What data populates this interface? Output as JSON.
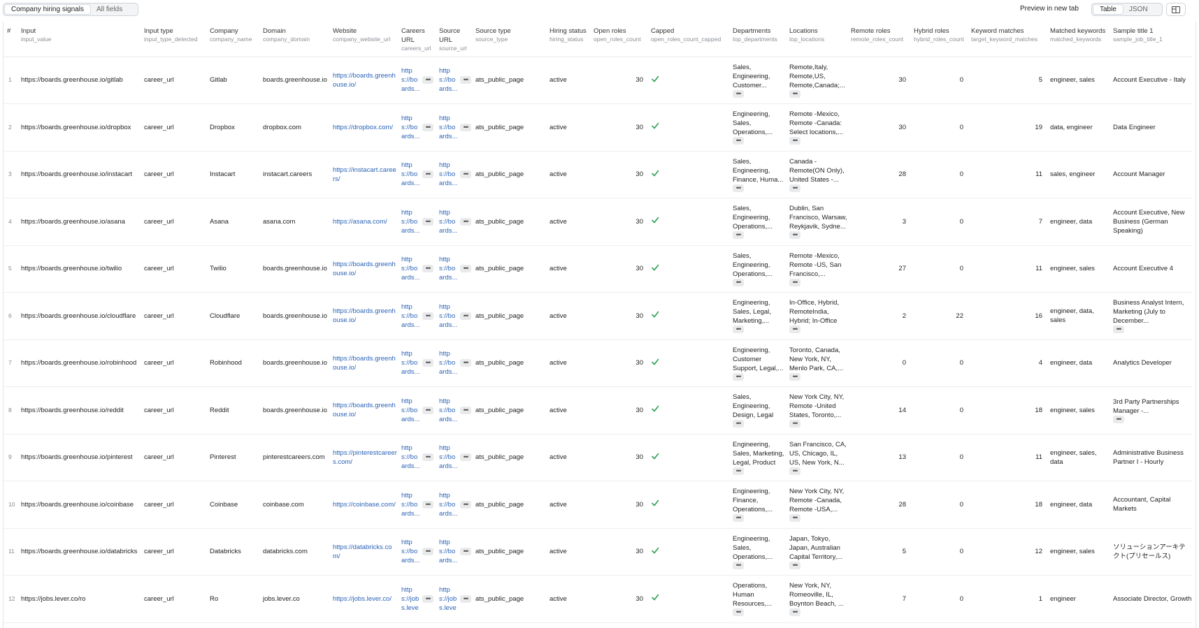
{
  "toolbar": {
    "view_tabs": [
      {
        "label": "Company hiring signals",
        "active": true
      },
      {
        "label": "All fields",
        "active": false
      }
    ],
    "preview_link": "Preview in new tab",
    "format_tabs": [
      {
        "label": "Table",
        "active": true
      },
      {
        "label": "JSON",
        "active": false
      }
    ],
    "layout_icon": "columns-icon"
  },
  "ellipsis": "•••",
  "columns": [
    {
      "label": "#",
      "key": ""
    },
    {
      "label": "Input",
      "key": "input_value"
    },
    {
      "label": "Input type",
      "key": "input_type_detected"
    },
    {
      "label": "Company",
      "key": "company_name"
    },
    {
      "label": "Domain",
      "key": "company_domain"
    },
    {
      "label": "Website",
      "key": "company_website_url"
    },
    {
      "label": "Careers URL",
      "key": "careers_url"
    },
    {
      "label": "Source URL",
      "key": "source_url"
    },
    {
      "label": "Source type",
      "key": "source_type"
    },
    {
      "label": "Hiring status",
      "key": "hiring_status"
    },
    {
      "label": "Open roles",
      "key": "open_roles_count"
    },
    {
      "label": "Capped",
      "key": "open_roles_count_capped"
    },
    {
      "label": "Departments",
      "key": "top_departments"
    },
    {
      "label": "Locations",
      "key": "top_locations"
    },
    {
      "label": "Remote roles",
      "key": "remote_roles_count"
    },
    {
      "label": "Hybrid roles",
      "key": "hybrid_roles_count"
    },
    {
      "label": "Keyword matches",
      "key": "target_keyword_matches"
    },
    {
      "label": "Matched keywords",
      "key": "matched_keywords"
    },
    {
      "label": "Sample title 1",
      "key": "sample_job_title_1"
    }
  ],
  "rows": [
    {
      "idx": "1",
      "input": "https://boards.greenhouse.io/gitlab",
      "input_type": "career_url",
      "company": "Gitlab",
      "domain": "boards.greenhouse.io",
      "website": "https://boards.greenhouse.io/",
      "careers_url": "https://boards...",
      "source_url": "https://boards...",
      "source_type": "ats_public_page",
      "hiring_status": "active",
      "open_roles": "30",
      "capped": true,
      "departments": "Sales, Engineering, Customer...",
      "locations": "Remote,Italy, Remote,US, Remote,Canada;...",
      "remote_roles": "30",
      "hybrid_roles": "0",
      "keyword_matches": "5",
      "matched_keywords": "engineer, sales",
      "sample_title": "Account Executive - Italy",
      "title_more": false
    },
    {
      "idx": "2",
      "input": "https://boards.greenhouse.io/dropbox",
      "input_type": "career_url",
      "company": "Dropbox",
      "domain": "dropbox.com",
      "website": "https://dropbox.com/",
      "careers_url": "https://boards...",
      "source_url": "https://boards...",
      "source_type": "ats_public_page",
      "hiring_status": "active",
      "open_roles": "30",
      "capped": true,
      "departments": "Engineering, Sales, Operations,...",
      "locations": "Remote -Mexico, Remote -Canada: Select locations,...",
      "remote_roles": "30",
      "hybrid_roles": "0",
      "keyword_matches": "19",
      "matched_keywords": "data, engineer",
      "sample_title": "Data Engineer",
      "title_more": false
    },
    {
      "idx": "3",
      "input": "https://boards.greenhouse.io/instacart",
      "input_type": "career_url",
      "company": "Instacart",
      "domain": "instacart.careers",
      "website": "https://instacart.careers/",
      "careers_url": "https://boards...",
      "source_url": "https://boards...",
      "source_type": "ats_public_page",
      "hiring_status": "active",
      "open_roles": "30",
      "capped": true,
      "departments": "Sales, Engineering, Finance, Huma...",
      "locations": "Canada - Remote(ON Only), United States -...",
      "remote_roles": "28",
      "hybrid_roles": "0",
      "keyword_matches": "11",
      "matched_keywords": "sales, engineer",
      "sample_title": "Account Manager",
      "title_more": false
    },
    {
      "idx": "4",
      "input": "https://boards.greenhouse.io/asana",
      "input_type": "career_url",
      "company": "Asana",
      "domain": "asana.com",
      "website": "https://asana.com/",
      "careers_url": "https://boards...",
      "source_url": "https://boards...",
      "source_type": "ats_public_page",
      "hiring_status": "active",
      "open_roles": "30",
      "capped": true,
      "departments": "Sales, Engineering, Operations,...",
      "locations": "Dublin, San Francisco, Warsaw, Reykjavik, Sydne...",
      "remote_roles": "3",
      "hybrid_roles": "0",
      "keyword_matches": "7",
      "matched_keywords": "engineer, data",
      "sample_title": "Account Executive, New Business (German Speaking)",
      "title_more": false
    },
    {
      "idx": "5",
      "input": "https://boards.greenhouse.io/twilio",
      "input_type": "career_url",
      "company": "Twilio",
      "domain": "boards.greenhouse.io",
      "website": "https://boards.greenhouse.io/",
      "careers_url": "https://boards...",
      "source_url": "https://boards...",
      "source_type": "ats_public_page",
      "hiring_status": "active",
      "open_roles": "30",
      "capped": true,
      "departments": "Sales, Engineering, Operations,...",
      "locations": "Remote -Mexico, Remote -US, San Francisco,...",
      "remote_roles": "27",
      "hybrid_roles": "0",
      "keyword_matches": "11",
      "matched_keywords": "engineer, sales",
      "sample_title": "Account Executive 4",
      "title_more": false
    },
    {
      "idx": "6",
      "input": "https://boards.greenhouse.io/cloudflare",
      "input_type": "career_url",
      "company": "Cloudflare",
      "domain": "boards.greenhouse.io",
      "website": "https://boards.greenhouse.io/",
      "careers_url": "https://boards...",
      "source_url": "https://boards...",
      "source_type": "ats_public_page",
      "hiring_status": "active",
      "open_roles": "30",
      "capped": true,
      "departments": "Engineering, Sales, Legal, Marketing,...",
      "locations": "In-Office, Hybrid, RemoteIndia, Hybrid; In-Office",
      "remote_roles": "2",
      "hybrid_roles": "22",
      "keyword_matches": "16",
      "matched_keywords": "engineer, data, sales",
      "sample_title": "Business Analyst Intern, Marketing (July to December...",
      "title_more": true
    },
    {
      "idx": "7",
      "input": "https://boards.greenhouse.io/robinhood",
      "input_type": "career_url",
      "company": "Robinhood",
      "domain": "boards.greenhouse.io",
      "website": "https://boards.greenhouse.io/",
      "careers_url": "https://boards...",
      "source_url": "https://boards...",
      "source_type": "ats_public_page",
      "hiring_status": "active",
      "open_roles": "30",
      "capped": true,
      "departments": "Engineering, Customer Support, Legal,...",
      "locations": "Toronto, Canada, New York, NY, Menlo Park, CA,...",
      "remote_roles": "0",
      "hybrid_roles": "0",
      "keyword_matches": "4",
      "matched_keywords": "engineer, data",
      "sample_title": "Analytics Developer",
      "title_more": false
    },
    {
      "idx": "8",
      "input": "https://boards.greenhouse.io/reddit",
      "input_type": "career_url",
      "company": "Reddit",
      "domain": "boards.greenhouse.io",
      "website": "https://boards.greenhouse.io/",
      "careers_url": "https://boards...",
      "source_url": "https://boards...",
      "source_type": "ats_public_page",
      "hiring_status": "active",
      "open_roles": "30",
      "capped": true,
      "departments": "Sales, Engineering, Design, Legal",
      "locations": "New York City, NY, Remote -United States, Toronto,...",
      "remote_roles": "14",
      "hybrid_roles": "0",
      "keyword_matches": "18",
      "matched_keywords": "engineer, sales",
      "sample_title": "3rd Party Partnerships Manager -...",
      "title_more": true
    },
    {
      "idx": "9",
      "input": "https://boards.greenhouse.io/pinterest",
      "input_type": "career_url",
      "company": "Pinterest",
      "domain": "pinterestcareers.com",
      "website": "https://pinterestcareers.com/",
      "careers_url": "https://boards...",
      "source_url": "https://boards...",
      "source_type": "ats_public_page",
      "hiring_status": "active",
      "open_roles": "30",
      "capped": true,
      "departments": "Engineering, Sales, Marketing, Legal, Product",
      "locations": "San Francisco, CA, US, Chicago, IL, US, New York, N...",
      "remote_roles": "13",
      "hybrid_roles": "0",
      "keyword_matches": "11",
      "matched_keywords": "engineer, sales, data",
      "sample_title": "Administrative Business Partner I - Hourly",
      "title_more": false
    },
    {
      "idx": "10",
      "input": "https://boards.greenhouse.io/coinbase",
      "input_type": "career_url",
      "company": "Coinbase",
      "domain": "coinbase.com",
      "website": "https://coinbase.com/",
      "careers_url": "https://boards...",
      "source_url": "https://boards...",
      "source_type": "ats_public_page",
      "hiring_status": "active",
      "open_roles": "30",
      "capped": true,
      "departments": "Engineering, Finance, Operations,...",
      "locations": "New York City, NY, Remote -Canada, Remote -USA,...",
      "remote_roles": "28",
      "hybrid_roles": "0",
      "keyword_matches": "18",
      "matched_keywords": "engineer, data",
      "sample_title": "Accountant, Capital Markets",
      "title_more": false
    },
    {
      "idx": "11",
      "input": "https://boards.greenhouse.io/databricks",
      "input_type": "career_url",
      "company": "Databricks",
      "domain": "databricks.com",
      "website": "https://databricks.com/",
      "careers_url": "https://boards...",
      "source_url": "https://boards...",
      "source_type": "ats_public_page",
      "hiring_status": "active",
      "open_roles": "30",
      "capped": true,
      "departments": "Engineering, Sales, Operations,...",
      "locations": "Japan, Tokyo, Japan, Australian Capital Territory,...",
      "remote_roles": "5",
      "hybrid_roles": "0",
      "keyword_matches": "12",
      "matched_keywords": "engineer, sales",
      "sample_title": "ソリューションアーキテクト(プリセールス)",
      "title_more": false
    },
    {
      "idx": "12",
      "input": "https://jobs.lever.co/ro",
      "input_type": "career_url",
      "company": "Ro",
      "domain": "jobs.lever.co",
      "website": "https://jobs.lever.co/",
      "careers_url": "https://jobs.lever.co/ro",
      "source_url": "https://jobs.lever.co/ro",
      "source_type": "ats_public_page",
      "hiring_status": "active",
      "open_roles": "30",
      "capped": true,
      "departments": "Operations, Human Resources,...",
      "locations": "New York, NY, Romeoville, IL, Boynton Beach, ...",
      "remote_roles": "7",
      "hybrid_roles": "0",
      "keyword_matches": "1",
      "matched_keywords": "engineer",
      "sample_title": "Associate Director, Growth",
      "title_more": false
    }
  ]
}
